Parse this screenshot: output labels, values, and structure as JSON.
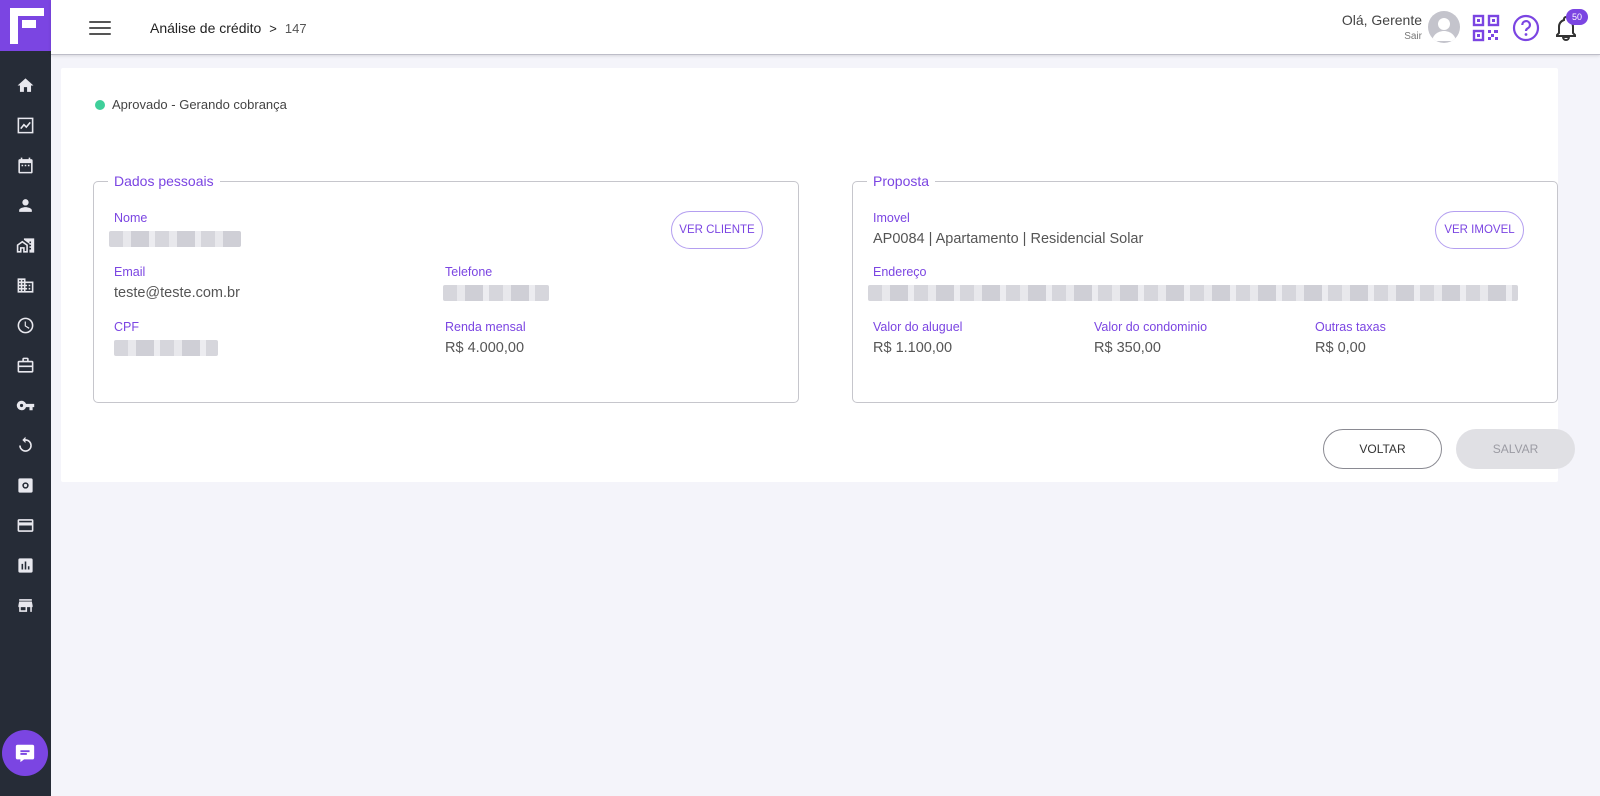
{
  "header": {
    "breadcrumb_section": "Análise de crédito",
    "breadcrumb_separator": ">",
    "breadcrumb_current": "147",
    "greeting": "Olá, Gerente",
    "logout": "Sair",
    "notifications_count": "50"
  },
  "sidebar": {
    "icons": [
      "home-icon",
      "trending-icon",
      "calendar-icon",
      "person-icon",
      "property-icon",
      "building-icon",
      "clock-icon",
      "briefcase-icon",
      "key-icon",
      "restore-icon",
      "settings-icon",
      "credit-card-icon",
      "report-icon",
      "store-icon"
    ],
    "chat": "chat-icon"
  },
  "status": {
    "text": "Aprovado - Gerando cobrança",
    "color": "#3fcf9a"
  },
  "personal": {
    "legend": "Dados pessoais",
    "name_label": "Nome",
    "email_label": "Email",
    "email_value": "teste@teste.com.br",
    "phone_label": "Telefone",
    "cpf_label": "CPF",
    "income_label": "Renda mensal",
    "income_value": "R$  4.000,00",
    "view_button": "VER CLIENTE"
  },
  "proposal": {
    "legend": "Proposta",
    "property_label": "Imovel",
    "property_value": "AP0084 | Apartamento | Residencial Solar",
    "address_label": "Endereço",
    "rent_label": "Valor do aluguel",
    "rent_value": "R$  1.100,00",
    "condo_label": "Valor do condominio",
    "condo_value": "R$  350,00",
    "other_label": "Outras taxas",
    "other_value": "R$  0,00",
    "view_button": "VER IMOVEL"
  },
  "actions": {
    "back": "VOLTAR",
    "save": "SALVAR"
  },
  "colors": {
    "accent": "#7b45e2",
    "sidebar": "#262c37",
    "background": "#f4f4fa"
  }
}
